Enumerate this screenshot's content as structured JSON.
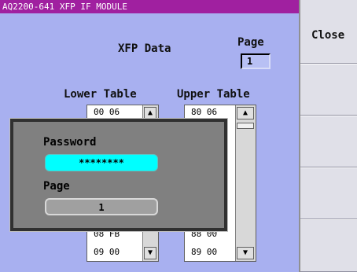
{
  "window": {
    "title": "AQ2200-641 XFP IF MODULE"
  },
  "panel": {
    "title": "XFP Data",
    "page_label": "Page",
    "page_value": "1"
  },
  "lower_table": {
    "header": "Lower Table",
    "top_value": "00 06",
    "bottom_values": [
      "08 FB",
      "09 00"
    ]
  },
  "upper_table": {
    "header": "Upper Table",
    "top_value": "80 06",
    "bottom_values": [
      "88 00",
      "89 00"
    ]
  },
  "dialog": {
    "password_label": "Password",
    "password_value": "********",
    "page_label": "Page",
    "page_value": "1"
  },
  "sidebar": {
    "close_label": "Close"
  },
  "colors": {
    "title_bar": "#a020a0",
    "panel_bg": "#a8b0f0",
    "password_field": "#00ffff"
  },
  "icons": {
    "scroll_up": "triangle-up-icon",
    "scroll_down": "triangle-down-icon"
  }
}
